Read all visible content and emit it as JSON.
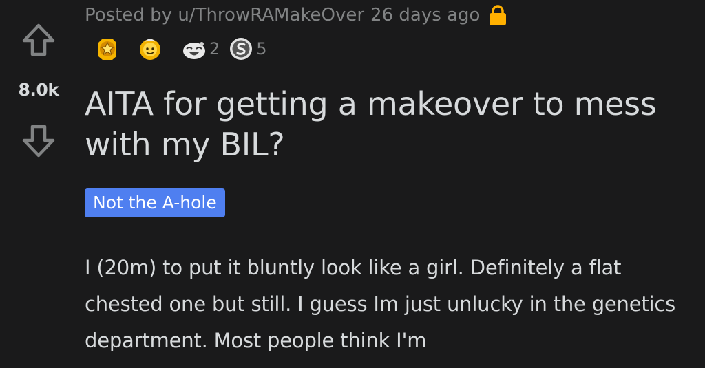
{
  "post": {
    "meta": {
      "posted_by": "Posted by u/ThrowRAMakeOver",
      "age": "26 days ago",
      "lock_icon": "lock-icon",
      "lock_color": "#ffb000"
    },
    "awards": [
      {
        "icon": "helpful-award-icon",
        "count": ""
      },
      {
        "icon": "wholesome-seal-award-icon",
        "count": ""
      },
      {
        "icon": "laughing-face-award-icon",
        "count": "2"
      },
      {
        "icon": "silver-coin-award-icon",
        "count": "5"
      }
    ],
    "score": "8.0k",
    "title": "AITA for getting a makeover to mess with my BIL?",
    "flair": {
      "text": "Not the A-hole",
      "color": "#4f7ff0"
    },
    "body": "I (20m) to put it bluntly look like a girl. Definitely a flat chested one but still. I guess Im just unlucky in the genetics department. Most people think I'm"
  },
  "theme": {
    "background": "#1a1a1b",
    "text": "#d7dadc",
    "muted": "#818384"
  }
}
